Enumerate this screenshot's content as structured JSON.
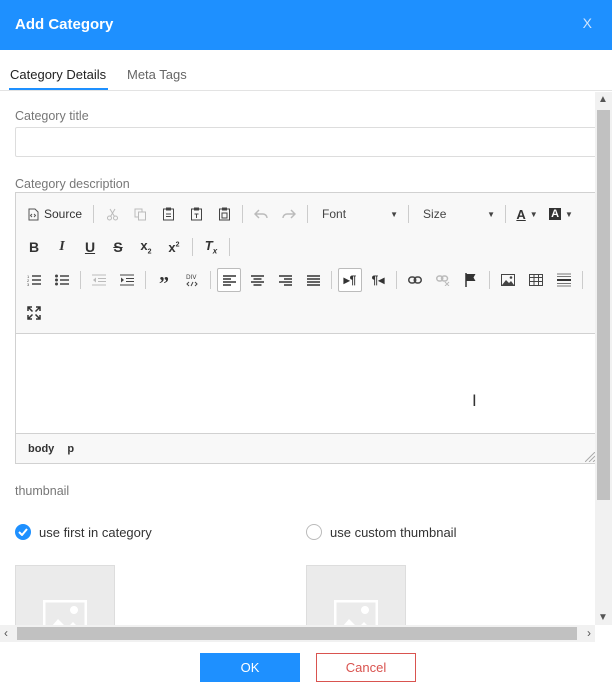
{
  "dialog": {
    "title": "Add Category",
    "close_label": "X"
  },
  "tabs": [
    {
      "label": "Category Details",
      "active": true
    },
    {
      "label": "Meta Tags",
      "active": false
    }
  ],
  "form": {
    "title_label": "Category title",
    "title_value": "",
    "description_label": "Category description",
    "thumbnail_label": "thumbnail"
  },
  "editor": {
    "source_label": "Source",
    "font_label": "Font",
    "size_label": "Size",
    "path": [
      "body",
      "p"
    ],
    "content": ""
  },
  "thumbnail": {
    "options": [
      {
        "label": "use first in category",
        "selected": true
      },
      {
        "label": "use custom thumbnail",
        "selected": false
      }
    ]
  },
  "footer": {
    "ok_label": "OK",
    "cancel_label": "Cancel"
  },
  "colors": {
    "accent": "#1e90ff",
    "danger": "#d9534f"
  }
}
